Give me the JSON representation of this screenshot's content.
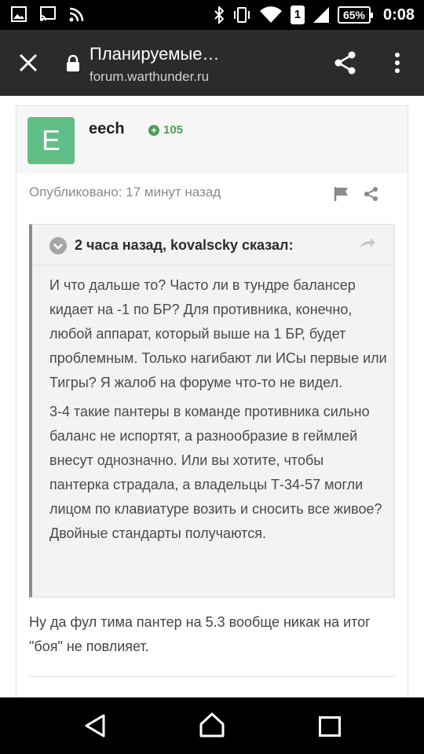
{
  "status_bar": {
    "time": "0:08",
    "battery": "65%",
    "sim": "1"
  },
  "toolbar": {
    "title": "Планируемые…",
    "url": "forum.warthunder.ru"
  },
  "post": {
    "avatar_letter": "E",
    "author": "eech",
    "reputation": "105",
    "published": "Опубликовано: 17 минут назад",
    "quote": {
      "title": "2 часа назад, kovalscky сказал:",
      "paragraphs": [
        "И что дальше то? Часто ли в тундре балансер кидает на -1 по БР? Для противника, конечно, любой аппарат, который выше на 1 БР, будет проблемным. Только нагибают ли ИСы первые или Тигры? Я жалоб на форуме что-то не видел.",
        "3-4 такие пантеры в команде противника сильно баланс не испортят, а разнообразие в геймлей внесут однозначно. Или вы хотите, чтобы пантерка страдала, а владельцы Т-34-57 могли лицом по клавиатуре возить и сносить все живое? Двойные стандарты получаются."
      ]
    },
    "text": "Ну да фул тима пантер на 5.3 вообще никак на итог \"боя\" не повлияет."
  },
  "colors": {
    "avatar_bg": "#5fbf86",
    "reputation": "#4f9c5e",
    "toolbar_bg": "#2b2b2d"
  },
  "icons": [
    "image-icon",
    "cast-icon",
    "rss-icon",
    "bluetooth-icon",
    "vibrate-icon",
    "wifi-icon",
    "signal-icon",
    "battery-icon",
    "close-icon",
    "lock-icon",
    "share-icon",
    "more-vert-icon",
    "flag-icon",
    "share-small-icon",
    "chevron-down-icon",
    "reply-icon",
    "back-icon",
    "home-icon",
    "recents-icon"
  ]
}
